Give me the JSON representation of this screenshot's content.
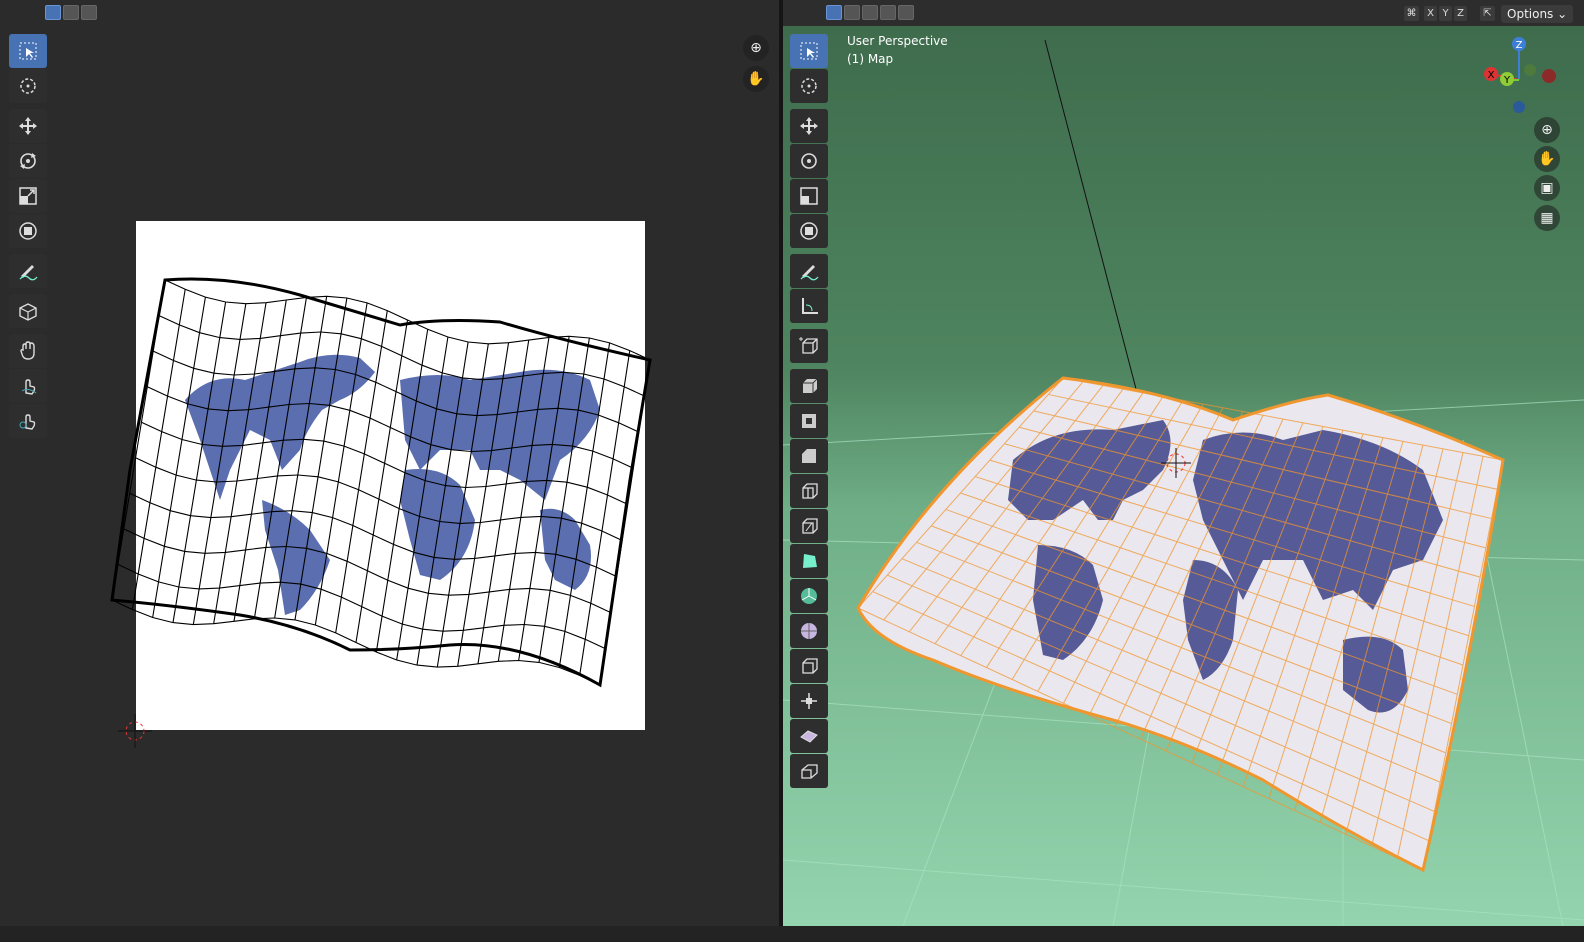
{
  "uv_editor": {
    "select_modes": [
      "vertex",
      "edge",
      "face"
    ],
    "tools": [
      "select-box",
      "cursor",
      "move",
      "rotate",
      "scale",
      "transform",
      "annotate",
      "rip",
      "grab",
      "relax",
      "pinch"
    ],
    "nav": [
      "zoom-icon",
      "hand-icon"
    ]
  },
  "viewport": {
    "select_modes": [
      "vertex",
      "edge",
      "face",
      "island",
      "island2"
    ],
    "view_name": "User Perspective",
    "object_name": "(1) Map",
    "axis_buttons": [
      "X",
      "Y",
      "Z"
    ],
    "options_label": "Options",
    "gizmo": {
      "z": "Z",
      "y": "Y",
      "x": "X"
    },
    "tools": [
      "select-box",
      "cursor",
      "move",
      "rotate",
      "scale",
      "transform",
      "annotate",
      "measure",
      "add-cube",
      "extrude",
      "inset",
      "bevel",
      "loop-cut",
      "knife",
      "poly-build",
      "spin",
      "smooth",
      "shrink-fatten",
      "shear",
      "rip-region",
      "rip-edge"
    ]
  },
  "colors": {
    "accent": "#4772b3",
    "map_land_uv": "#5b6fb0",
    "map_land_3d": "#565a96",
    "wire_3d": "#f0962e",
    "viewport_floor": "#94d4ae"
  }
}
